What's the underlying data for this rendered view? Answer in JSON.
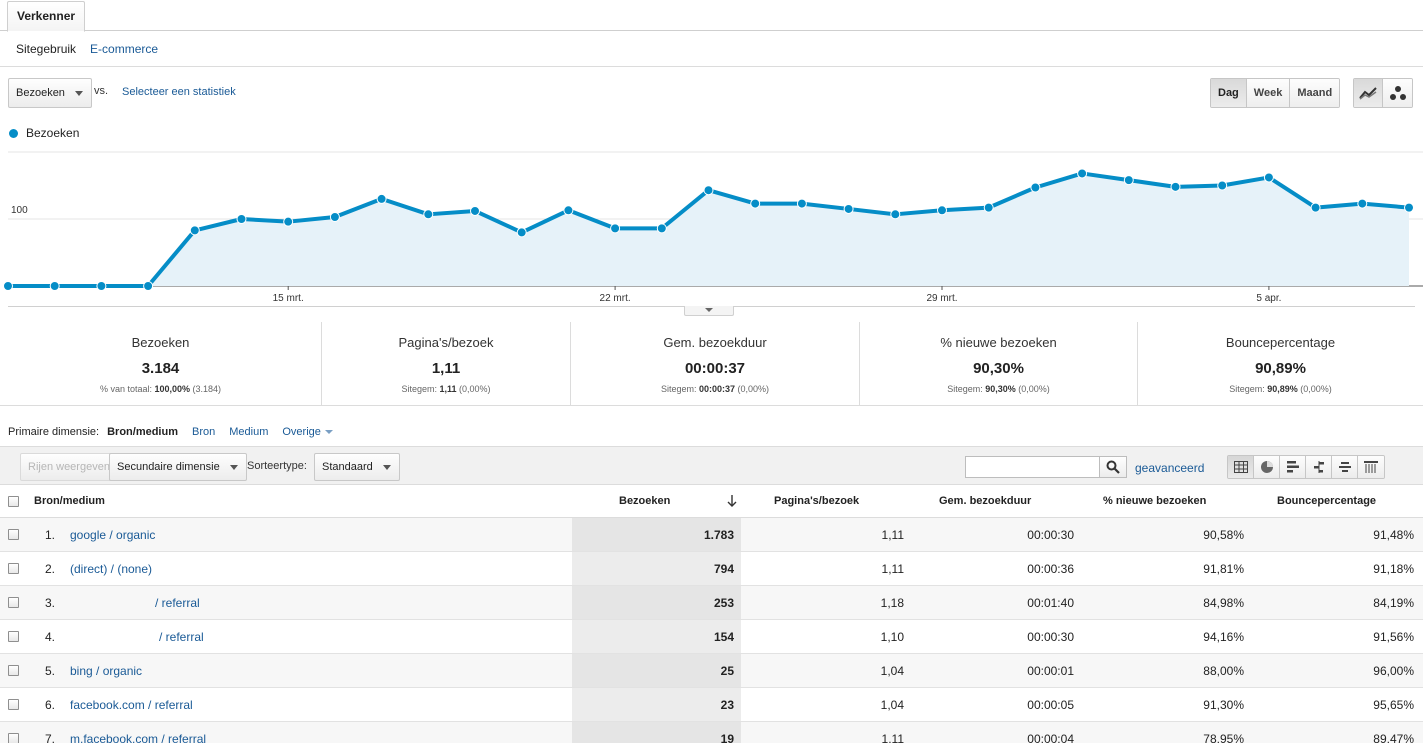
{
  "tabs": {
    "explorer": "Verkenner"
  },
  "subnav": {
    "site_usage": "Sitegebruik",
    "ecommerce": "E-commerce"
  },
  "metric_selector": {
    "selected": "Bezoeken",
    "vs": "vs.",
    "select_stat": "Selecteer een statistiek"
  },
  "granularity": {
    "day": "Dag",
    "week": "Week",
    "month": "Maand",
    "selected": "Dag"
  },
  "chart_icons": [
    "line-chart-icon",
    "motion-chart-icon"
  ],
  "chart_data": {
    "type": "area",
    "series": [
      {
        "name": "Bezoeken",
        "color": "#058dc7",
        "values": [
          0,
          0,
          0,
          0,
          83,
          100,
          96,
          103,
          130,
          107,
          112,
          80,
          113,
          86,
          86,
          143,
          123,
          123,
          115,
          107,
          113,
          117,
          147,
          168,
          158,
          148,
          150,
          162,
          117,
          123,
          117
        ]
      }
    ],
    "x_tick_labels": [
      {
        "label": "15 mrt.",
        "index": 6
      },
      {
        "label": "22 mrt.",
        "index": 13
      },
      {
        "label": "29 mrt.",
        "index": 20
      },
      {
        "label": "5 apr.",
        "index": 27
      }
    ],
    "y_ticks": [
      100,
      200
    ],
    "ylim": [
      0,
      200
    ],
    "grid": true
  },
  "scorecards": [
    {
      "label": "Bezoeken",
      "value": "3.184",
      "sub_label": "% van totaal:",
      "sub_value": "100,00%",
      "sub_extra": "(3.184)"
    },
    {
      "label": "Pagina's/bezoek",
      "value": "1,11",
      "sub_label": "Sitegem:",
      "sub_value": "1,11",
      "sub_extra": "(0,00%)"
    },
    {
      "label": "Gem. bezoekduur",
      "value": "00:00:37",
      "sub_label": "Sitegem:",
      "sub_value": "00:00:37",
      "sub_extra": "(0,00%)"
    },
    {
      "label": "% nieuwe bezoeken",
      "value": "90,30%",
      "sub_label": "Sitegem:",
      "sub_value": "90,30%",
      "sub_extra": "(0,00%)"
    },
    {
      "label": "Bouncepercentage",
      "value": "90,89%",
      "sub_label": "Sitegem:",
      "sub_value": "90,89%",
      "sub_extra": "(0,00%)"
    }
  ],
  "dimensions": {
    "label": "Primaire dimensie:",
    "current": "Bron/medium",
    "source": "Bron",
    "medium": "Medium",
    "other": "Overige"
  },
  "toolbar": {
    "show_rows": "Rijen weergeven",
    "secondary_dimension": "Secundaire dimensie",
    "sort_type_label": "Sorteertype:",
    "sort_type_value": "Standaard",
    "search_value": "",
    "advanced": "geavanceerd"
  },
  "table": {
    "headers": {
      "source": "Bron/medium",
      "visits": "Bezoeken",
      "pages": "Pagina's/bezoek",
      "duration": "Gem. bezoekduur",
      "new": "% nieuwe bezoeken",
      "bounce": "Bouncepercentage"
    },
    "rows": [
      {
        "num": "1.",
        "source": "google / organic",
        "visits": "1.783",
        "pages": "1,11",
        "duration": "00:00:30",
        "new": "90,58%",
        "bounce": "91,48%"
      },
      {
        "num": "2.",
        "source": "(direct) / (none)",
        "visits": "794",
        "pages": "1,11",
        "duration": "00:00:36",
        "new": "91,81%",
        "bounce": "91,18%"
      },
      {
        "num": "3.",
        "source": "/ referral",
        "visits": "253",
        "pages": "1,18",
        "duration": "00:01:40",
        "new": "84,98%",
        "bounce": "84,19%"
      },
      {
        "num": "4.",
        "source": "/ referral",
        "visits": "154",
        "pages": "1,10",
        "duration": "00:00:30",
        "new": "94,16%",
        "bounce": "91,56%"
      },
      {
        "num": "5.",
        "source": "bing / organic",
        "visits": "25",
        "pages": "1,04",
        "duration": "00:00:01",
        "new": "88,00%",
        "bounce": "96,00%"
      },
      {
        "num": "6.",
        "source": "facebook.com / referral",
        "visits": "23",
        "pages": "1,04",
        "duration": "00:00:05",
        "new": "91,30%",
        "bounce": "95,65%"
      },
      {
        "num": "7.",
        "source": "m.facebook.com / referral",
        "visits": "19",
        "pages": "1,11",
        "duration": "00:00:04",
        "new": "78,95%",
        "bounce": "89,47%"
      }
    ]
  }
}
